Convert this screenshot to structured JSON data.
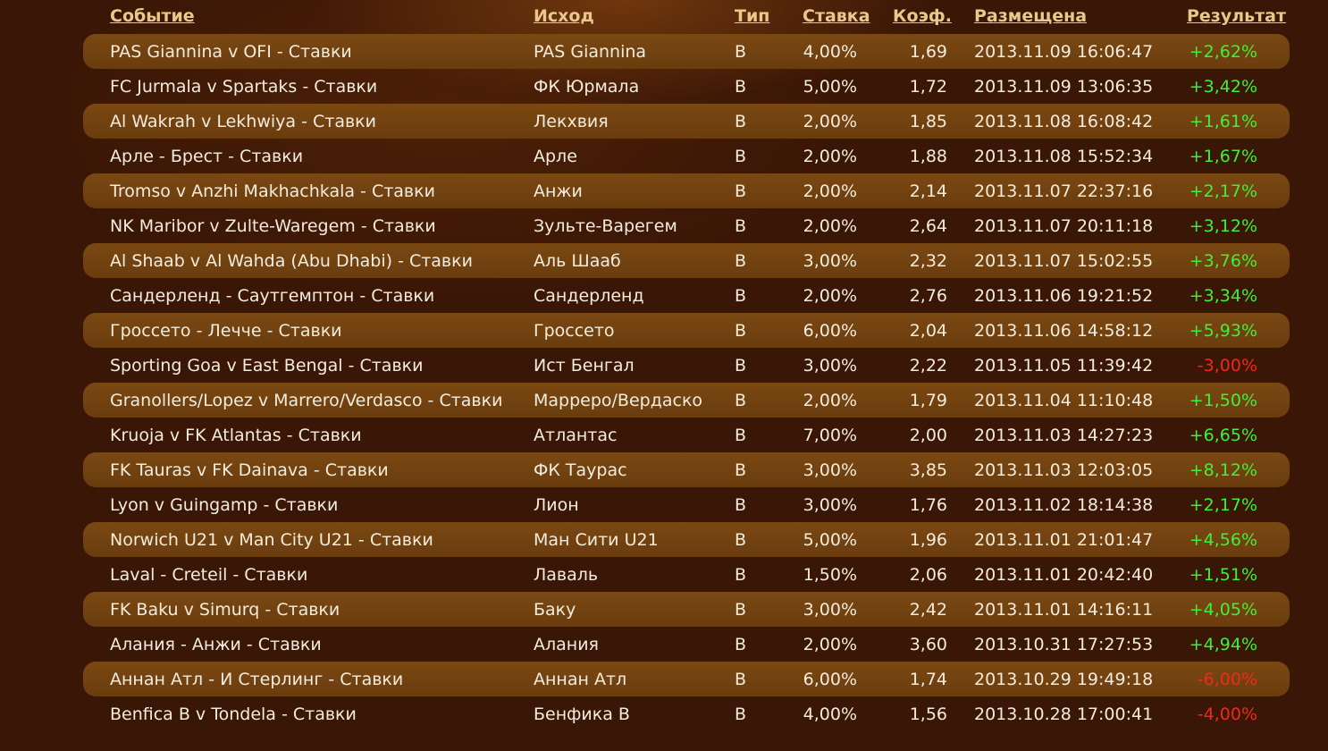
{
  "headers": {
    "event": "Событие",
    "outcome": "Исход",
    "type": "Тип",
    "stake": "Ставка",
    "odds": "Коэф.",
    "placed": "Размещена",
    "result": "Результат"
  },
  "rows": [
    {
      "event": "PAS Giannina v OFI - Ставки",
      "outcome": "PAS Giannina",
      "type": "B",
      "stake": "4,00%",
      "odds": "1,69",
      "placed": "2013.11.09 16:06:47",
      "result": "+2,62%",
      "status": "positive"
    },
    {
      "event": "FC Jurmala v Spartaks - Ставки",
      "outcome": "ФК Юрмала",
      "type": "B",
      "stake": "5,00%",
      "odds": "1,72",
      "placed": "2013.11.09 13:06:35",
      "result": "+3,42%",
      "status": "positive"
    },
    {
      "event": "Al Wakrah v Lekhwiya - Ставки",
      "outcome": "Лекхвия",
      "type": "B",
      "stake": "2,00%",
      "odds": "1,85",
      "placed": "2013.11.08 16:08:42",
      "result": "+1,61%",
      "status": "positive"
    },
    {
      "event": "Арле - Брест - Ставки",
      "outcome": "Арле",
      "type": "B",
      "stake": "2,00%",
      "odds": "1,88",
      "placed": "2013.11.08 15:52:34",
      "result": "+1,67%",
      "status": "positive"
    },
    {
      "event": "Tromso v Anzhi Makhachkala - Ставки",
      "outcome": "Анжи",
      "type": "B",
      "stake": "2,00%",
      "odds": "2,14",
      "placed": "2013.11.07 22:37:16",
      "result": "+2,17%",
      "status": "positive"
    },
    {
      "event": "NK Maribor v Zulte-Waregem - Ставки",
      "outcome": "Зульте-Варегем",
      "type": "B",
      "stake": "2,00%",
      "odds": "2,64",
      "placed": "2013.11.07 20:11:18",
      "result": "+3,12%",
      "status": "positive"
    },
    {
      "event": "Al Shaab v Al Wahda (Abu Dhabi) - Ставки",
      "outcome": "Аль Шааб",
      "type": "B",
      "stake": "3,00%",
      "odds": "2,32",
      "placed": "2013.11.07 15:02:55",
      "result": "+3,76%",
      "status": "positive"
    },
    {
      "event": "Сандерленд - Саутгемптон - Ставки",
      "outcome": "Сандерленд",
      "type": "B",
      "stake": "2,00%",
      "odds": "2,76",
      "placed": "2013.11.06 19:21:52",
      "result": "+3,34%",
      "status": "positive"
    },
    {
      "event": "Гроссето - Лечче - Ставки",
      "outcome": "Гроссето",
      "type": "B",
      "stake": "6,00%",
      "odds": "2,04",
      "placed": "2013.11.06 14:58:12",
      "result": "+5,93%",
      "status": "positive"
    },
    {
      "event": "Sporting Goa v East Bengal - Ставки",
      "outcome": "Ист Бенгал",
      "type": "B",
      "stake": "3,00%",
      "odds": "2,22",
      "placed": "2013.11.05 11:39:42",
      "result": "-3,00%",
      "status": "negative"
    },
    {
      "event": "Granollers/Lopez v Marrero/Verdasco - Ставки",
      "outcome": "Марреро/Вердаско",
      "type": "B",
      "stake": "2,00%",
      "odds": "1,79",
      "placed": "2013.11.04 11:10:48",
      "result": "+1,50%",
      "status": "positive"
    },
    {
      "event": "Kruoja v FK Atlantas - Ставки",
      "outcome": "Атлантас",
      "type": "B",
      "stake": "7,00%",
      "odds": "2,00",
      "placed": "2013.11.03 14:27:23",
      "result": "+6,65%",
      "status": "positive"
    },
    {
      "event": "FK Tauras v FK Dainava - Ставки",
      "outcome": "ФК Таурас",
      "type": "B",
      "stake": "3,00%",
      "odds": "3,85",
      "placed": "2013.11.03 12:03:05",
      "result": "+8,12%",
      "status": "positive"
    },
    {
      "event": "Lyon v Guingamp - Ставки",
      "outcome": "Лион",
      "type": "B",
      "stake": "3,00%",
      "odds": "1,76",
      "placed": "2013.11.02 18:14:38",
      "result": "+2,17%",
      "status": "positive"
    },
    {
      "event": "Norwich U21 v Man City U21 - Ставки",
      "outcome": "Ман Сити U21",
      "type": "B",
      "stake": "5,00%",
      "odds": "1,96",
      "placed": "2013.11.01 21:01:47",
      "result": "+4,56%",
      "status": "positive"
    },
    {
      "event": "Laval - Creteil - Ставки",
      "outcome": "Лаваль",
      "type": "B",
      "stake": "1,50%",
      "odds": "2,06",
      "placed": "2013.11.01 20:42:40",
      "result": "+1,51%",
      "status": "positive"
    },
    {
      "event": "FK Baku v Simurq - Ставки",
      "outcome": "Баку",
      "type": "B",
      "stake": "3,00%",
      "odds": "2,42",
      "placed": "2013.11.01 14:16:11",
      "result": "+4,05%",
      "status": "positive"
    },
    {
      "event": "Алания - Анжи - Ставки",
      "outcome": "Алания",
      "type": "B",
      "stake": "2,00%",
      "odds": "3,60",
      "placed": "2013.10.31 17:27:53",
      "result": "+4,94%",
      "status": "positive"
    },
    {
      "event": "Аннан Атл - И Стерлинг - Ставки",
      "outcome": "Аннан Атл",
      "type": "B",
      "stake": "6,00%",
      "odds": "1,74",
      "placed": "2013.10.29 19:49:18",
      "result": "-6,00%",
      "status": "negative"
    },
    {
      "event": "Benfica B v Tondela - Ставки",
      "outcome": "Бенфика B",
      "type": "B",
      "stake": "4,00%",
      "odds": "1,56",
      "placed": "2013.10.28 17:00:41",
      "result": "-4,00%",
      "status": "negative"
    }
  ],
  "colors": {
    "positive": "#3ef03a",
    "negative": "#f02a1a",
    "header": "#e9c98a"
  }
}
